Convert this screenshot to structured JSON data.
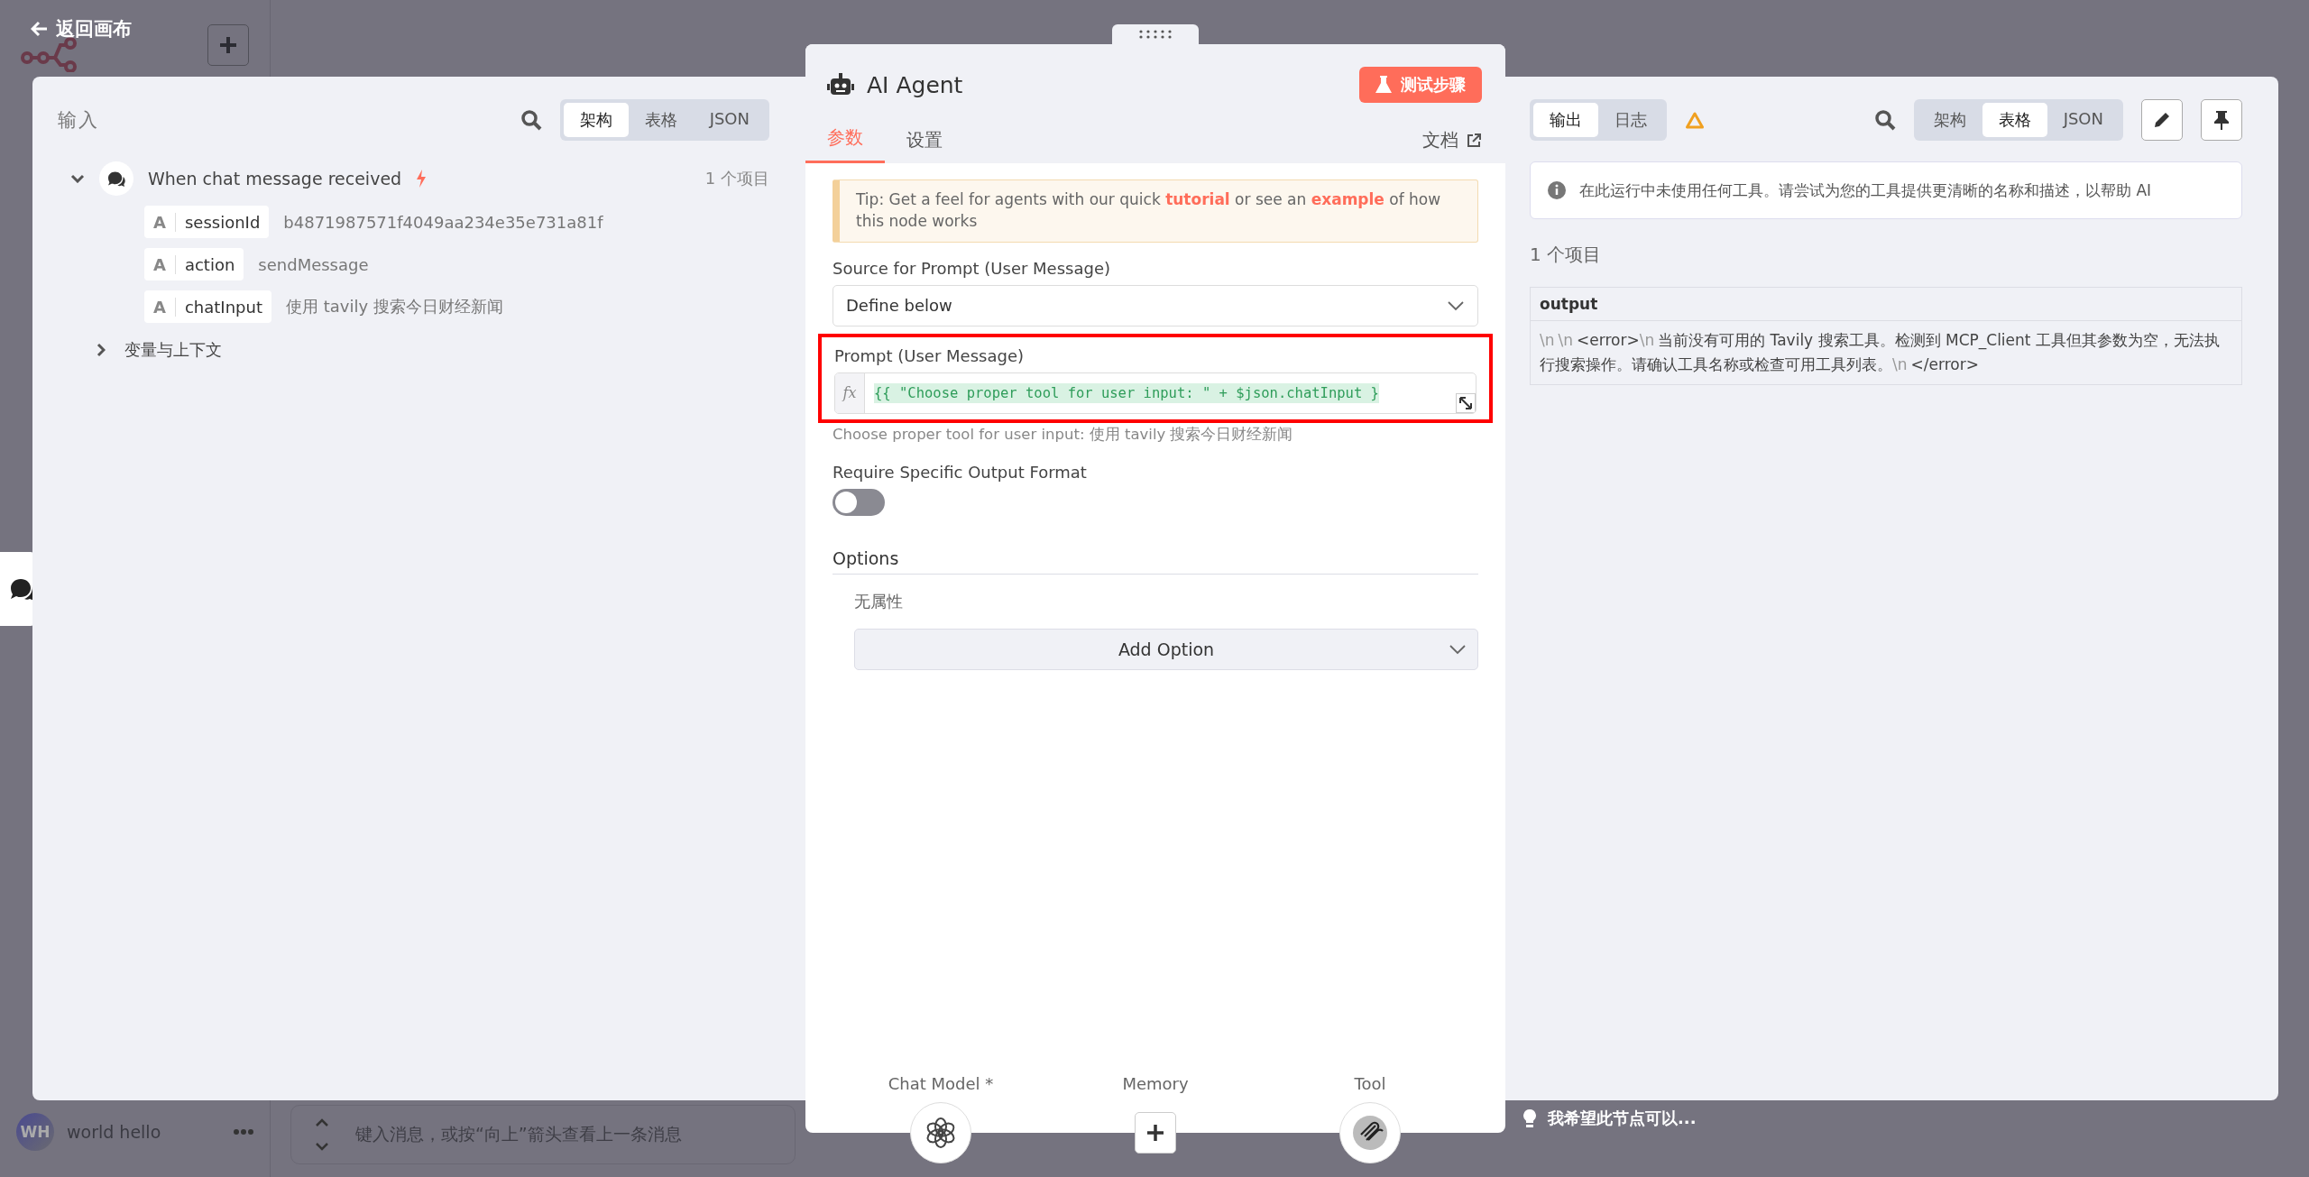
{
  "back_link": "返回画布",
  "background": {
    "user": {
      "initials": "WH",
      "name": "world hello"
    },
    "chat_input": {
      "placeholder": "键入消息，或按“向上”箭头查看上一条消息"
    }
  },
  "input_panel": {
    "title": "输入",
    "view_tabs": [
      {
        "label": "架构",
        "selected": true
      },
      {
        "label": "表格",
        "selected": false
      },
      {
        "label": "JSON",
        "selected": false
      }
    ],
    "nodes": [
      {
        "name": "When chat message received",
        "expanded": true,
        "count": "1 个项目",
        "fields": [
          {
            "type_glyph": "A",
            "key": "sessionId",
            "value": "b4871987571f4049aa234e35e731a81f"
          },
          {
            "type_glyph": "A",
            "key": "action",
            "value": "sendMessage"
          },
          {
            "type_glyph": "A",
            "key": "chatInput",
            "value": "使用 tavily 搜索今日财经新闻"
          }
        ]
      }
    ],
    "variables": {
      "label": "变量与上下文",
      "expanded": false
    }
  },
  "node_panel": {
    "title": "AI Agent",
    "test_button": "测试步骤",
    "tabs": [
      {
        "label": "参数",
        "selected": true
      },
      {
        "label": "设置",
        "selected": false
      }
    ],
    "docs_link": "文档",
    "tip": [
      {
        "kind": "text",
        "text": "Tip: Get a feel for agents with our quick "
      },
      {
        "kind": "link",
        "text": "tutorial"
      },
      {
        "kind": "text",
        "text": " or see an "
      },
      {
        "kind": "link",
        "text": "example"
      },
      {
        "kind": "text",
        "text": " of how this node works"
      }
    ],
    "source": {
      "label": "Source for Prompt (User Message)",
      "value": "Define below"
    },
    "prompt": {
      "label": "Prompt (User Message)",
      "fx": "fx",
      "expression": "{{ \"Choose proper tool for user input: \" + $json.chatInput }",
      "highlighted": true,
      "preview": "Choose proper tool for user input: 使用 tavily 搜索今日财经新闻"
    },
    "output_format": {
      "label": "Require Specific Output Format",
      "on": false
    },
    "options": {
      "title": "Options",
      "empty_text": "无属性",
      "add_button": "Add Option"
    },
    "connectors": [
      {
        "label": "Chat Model *",
        "kind": "model"
      },
      {
        "label": "Memory",
        "kind": "add"
      },
      {
        "label": "Tool",
        "kind": "tool"
      }
    ]
  },
  "output_panel": {
    "tabs": [
      {
        "label": "输出",
        "selected": true
      },
      {
        "label": "日志",
        "selected": false
      }
    ],
    "warning": true,
    "view_tabs": [
      {
        "label": "架构",
        "selected": false
      },
      {
        "label": "表格",
        "selected": true
      },
      {
        "label": "JSON",
        "selected": false
      }
    ],
    "info": "在此运行中未使用任何工具。请尝试为您的工具提供更清晰的名称和描述，以帮助 AI",
    "count": "1 个项目",
    "table": {
      "columns": [
        "output"
      ],
      "rows": [
        [
          [
            {
              "kind": "escape",
              "text": "\\n"
            },
            {
              "kind": "escape",
              "text": "\\n"
            },
            {
              "kind": "text",
              "text": "<error>"
            },
            {
              "kind": "escape",
              "text": "\\n"
            },
            {
              "kind": "text",
              "text": "当前没有可用的 Tavily 搜索工具。检测到 MCP_Client 工具但其参数为空，无法执行搜索操作。请确认工具名称或检查可用工具列表。"
            },
            {
              "kind": "escape",
              "text": "\\n"
            },
            {
              "kind": "text",
              "text": "</error>"
            }
          ]
        ]
      ]
    }
  },
  "hint": "我希望此节点可以..."
}
